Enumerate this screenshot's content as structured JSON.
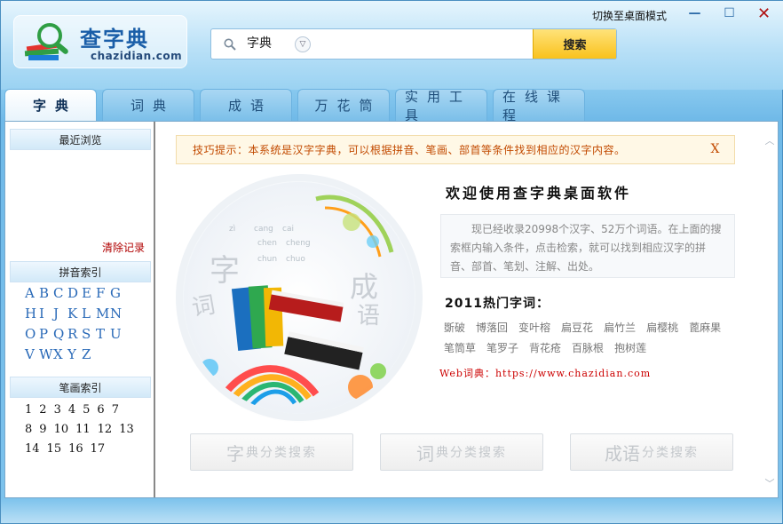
{
  "app": {
    "logo_title": "查字典",
    "logo_sub": "chazidian.com",
    "mode_switch": "切换至桌面模式",
    "window_controls": {
      "minimize": "—",
      "maximize": "☐",
      "close": "✕"
    }
  },
  "search": {
    "value": "字典",
    "dropdown_icon": "chevron-down-icon",
    "button": "搜索"
  },
  "tabs": [
    "字典",
    "词典",
    "成语",
    "万花筒",
    "实用工具",
    "在线课程"
  ],
  "sidebar": {
    "recent_title": "最近浏览",
    "clear": "清除记录",
    "pinyin_title": "拼音索引",
    "letters": [
      "A",
      "B",
      "C",
      "D",
      "E",
      "F",
      "G",
      "H",
      "I",
      "J",
      "K",
      "L",
      "M",
      "N",
      "O",
      "P",
      "Q",
      "R",
      "S",
      "T",
      "U",
      "V",
      "W",
      "X",
      "Y",
      "Z"
    ],
    "stroke_title": "笔画索引",
    "strokes": [
      [
        "1",
        "2",
        "3",
        "4",
        "5",
        "6",
        "7"
      ],
      [
        "8",
        "9",
        "10",
        "11",
        "12",
        "13"
      ],
      [
        "14",
        "15",
        "16",
        "17"
      ]
    ]
  },
  "panel": {
    "tip": "技巧提示：本系统是汉字字典，可以根据拼音、笔画、部首等条件找到相应的汉字内容。",
    "tip_close": "X",
    "welcome": "欢迎使用查字典桌面软件",
    "intro": "现已经收录20998个汉字、52万个词语。在上面的搜索框内输入条件，点击检索，就可以找到相应汉字的拼音、部首、笔划、注解、出处。",
    "hot_title": "2011热门字词：",
    "hot_words": [
      "斲破",
      "博落回",
      "变叶榕",
      "扁豆花",
      "扁竹兰",
      "扁樱桃",
      "蓖麻果",
      "笔筒草",
      "笔罗子",
      "背花疮",
      "百脉根",
      "抱树莲"
    ],
    "web_line": "Web词典：https://www.chazidian.com",
    "hero": {
      "char1": "字",
      "char2": "词",
      "char3": "成",
      "char4": "语",
      "pinyin": [
        "zì",
        "cang",
        "cai",
        "chen",
        "cheng",
        "chun",
        "chuo"
      ]
    },
    "buttons": [
      {
        "big": "字",
        "small": "典分类搜索"
      },
      {
        "big": "词",
        "small": "典分类搜索"
      },
      {
        "big": "成语",
        "small": "分类搜索"
      }
    ]
  },
  "colors": {
    "accent": "#2a6ab8",
    "tip_text": "#c24a00",
    "search_btn": "#f9c21c"
  }
}
